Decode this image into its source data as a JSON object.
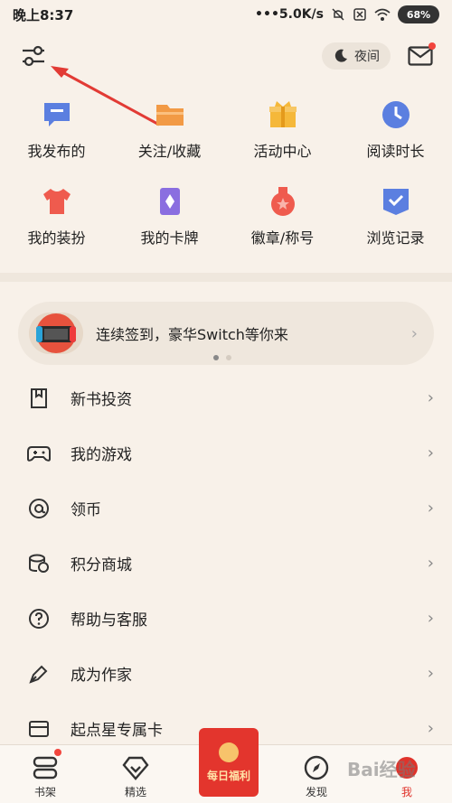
{
  "status_bar": {
    "time": "晚上8:37",
    "speed": "•••5.0K/s",
    "battery": "68%"
  },
  "top_bar": {
    "night_label": "夜间"
  },
  "quick_grid": [
    {
      "label": "我发布的",
      "icon": "message-icon",
      "color": "#5b7fe0"
    },
    {
      "label": "关注/收藏",
      "icon": "folder-icon",
      "color": "#f29a45"
    },
    {
      "label": "活动中心",
      "icon": "gift-icon",
      "color": "#f5b83a"
    },
    {
      "label": "阅读时长",
      "icon": "clock-icon",
      "color": "#5b7fe0"
    },
    {
      "label": "我的装扮",
      "icon": "shirt-icon",
      "color": "#ef5b4e"
    },
    {
      "label": "我的卡牌",
      "icon": "card-icon",
      "color": "#8a6ee0"
    },
    {
      "label": "徽章/称号",
      "icon": "medal-icon",
      "color": "#ef5b4e"
    },
    {
      "label": "浏览记录",
      "icon": "history-icon",
      "color": "#5b7fe0"
    }
  ],
  "banner": {
    "text": "连续签到，豪华Switch等你来"
  },
  "menu": [
    {
      "label": "新书投资",
      "icon": "bookmark-icon"
    },
    {
      "label": "我的游戏",
      "icon": "gamepad-icon"
    },
    {
      "label": "领币",
      "icon": "at-icon"
    },
    {
      "label": "积分商城",
      "icon": "coins-icon"
    },
    {
      "label": "帮助与客服",
      "icon": "help-icon"
    },
    {
      "label": "成为作家",
      "icon": "pen-icon"
    },
    {
      "label": "起点星专属卡",
      "icon": "credit-card-icon"
    }
  ],
  "bottom_nav": [
    {
      "label": "书架",
      "icon": "bookshelf-icon"
    },
    {
      "label": "精选",
      "icon": "diamond-icon"
    },
    {
      "label": "",
      "icon": ""
    },
    {
      "label": "发现",
      "icon": "compass-icon"
    },
    {
      "label": "我",
      "icon": "profile-icon"
    }
  ],
  "red_packet": {
    "label": "每日福利"
  },
  "watermark": "Bai经验",
  "colors": {
    "background": "#f8f1e9",
    "accent_red": "#e3352d"
  }
}
